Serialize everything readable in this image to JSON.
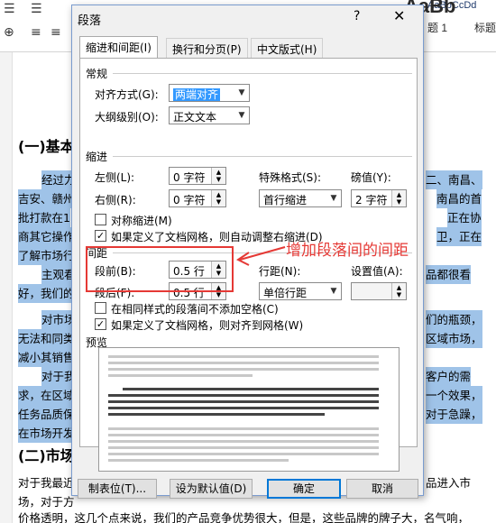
{
  "ribbon": {
    "style_preview_1": "AaBbCcDd",
    "style_preview_2": "AaBbCcDd",
    "style_preview_3": "AaBb",
    "style_label_1": "题 1",
    "style_label_2": "标题"
  },
  "document": {
    "heading_1": "(一)基本",
    "heading_2": "(二)市场",
    "lines": [
      "经过力",
      "吉安、赣州",
      "批打款在1",
      "商其它操作",
      "了解市场行",
      "主观看",
      "好，我们的",
      "对市场",
      "无法和同类",
      "减小其销售",
      "对于我",
      "求，在区域",
      "任务品质保",
      "在市场开发",
      "对于我最近",
      "场，对于方",
      "价格透明，这几个点来说，我们的产品竞争优势很大，但是，这些品牌的牌子大，名气响，"
    ],
    "right_lines": [
      "二、南昌、",
      "南昌的首",
      "正在协",
      "卫，正在",
      "品都很看",
      "们的瓶颈，",
      "区域市场，",
      "客户的需",
      "一个效果，",
      "对于急躁，",
      "品进入市",
      "场，对于方"
    ]
  },
  "dialog": {
    "title": "段落",
    "help": "?",
    "close": "✕",
    "tabs": [
      "缩进和间距(I)",
      "换行和分页(P)",
      "中文版式(H)"
    ],
    "general": {
      "section": "常规",
      "alignment_label": "对齐方式(G):",
      "alignment_value": "两端对齐",
      "outline_label": "大纲级别(O):",
      "outline_value": "正文文本"
    },
    "indent": {
      "section": "缩进",
      "left_label": "左侧(L):",
      "left_value": "0 字符",
      "right_label": "右侧(R):",
      "right_value": "0 字符",
      "special_label": "特殊格式(S):",
      "special_value": "首行缩进",
      "by_label": "磅值(Y):",
      "by_value": "2 字符",
      "mirror_label": "对称缩进(M)",
      "mirror_checked": false,
      "auto_adjust_label": "如果定义了文档网格，则自动调整右缩进(D)",
      "auto_adjust_checked": true
    },
    "spacing": {
      "section": "间距",
      "before_label": "段前(B):",
      "before_value": "0.5 行",
      "after_label": "段后(F):",
      "after_value": "0.5 行",
      "line_label": "行距(N):",
      "line_value": "单倍行距",
      "at_label": "设置值(A):",
      "at_value": "",
      "no_space_label": "在相同样式的段落间不添加空格(C)",
      "no_space_checked": false,
      "snap_grid_label": "如果定义了文档网格，则对齐到网格(W)",
      "snap_grid_checked": true
    },
    "preview": {
      "section": "预览"
    },
    "buttons": {
      "tabs": "制表位(T)...",
      "default": "设为默认值(D)",
      "ok": "确定",
      "cancel": "取消"
    }
  },
  "annotation": {
    "text": "增加段落间的间距",
    "color": "#e53935"
  }
}
